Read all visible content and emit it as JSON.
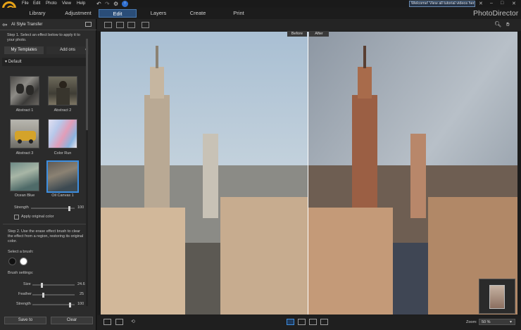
{
  "menu": [
    "File",
    "Edit",
    "Photo",
    "View",
    "Help"
  ],
  "welcome": "Welcome! View all tutorial videos here!",
  "tabs": [
    "Library",
    "Adjustment",
    "Edit",
    "Layers",
    "Create",
    "Print"
  ],
  "brand": "PhotoDirector",
  "panel": {
    "title": "AI Style Transfer",
    "step1": "Step 1. Select an effect below to apply it to your photo.",
    "tab_mine": "My Templates",
    "tab_addons": "Add ons",
    "group": "Default",
    "thumbs": [
      "Abstract 1",
      "Abstract 2",
      "Abstract 3",
      "Color Run",
      "Ocean Blue",
      "Oil Canvas 1"
    ],
    "strength_label": "Strength",
    "strength_value": "100",
    "apply_original": "Apply original color",
    "step2": "Step 2. Use the erase effect brush to clear the effect from a region, restoring its original color.",
    "select_brush": "Select a brush:",
    "brush_settings": "Brush settings:",
    "size_label": "Size",
    "size_value": "24.6",
    "feather_label": "Feather",
    "feather_value": "25",
    "strength2_label": "Strength",
    "strength2_value": "100",
    "save_to": "Save to",
    "clear": "Clear"
  },
  "canvas": {
    "before": "Before",
    "after": "After"
  },
  "zoom": {
    "label": "Zoom:",
    "value": "50 %"
  },
  "colors": {
    "accent": "#2a4d78",
    "selection": "#3d8ee0",
    "logo": "#e8a317"
  }
}
